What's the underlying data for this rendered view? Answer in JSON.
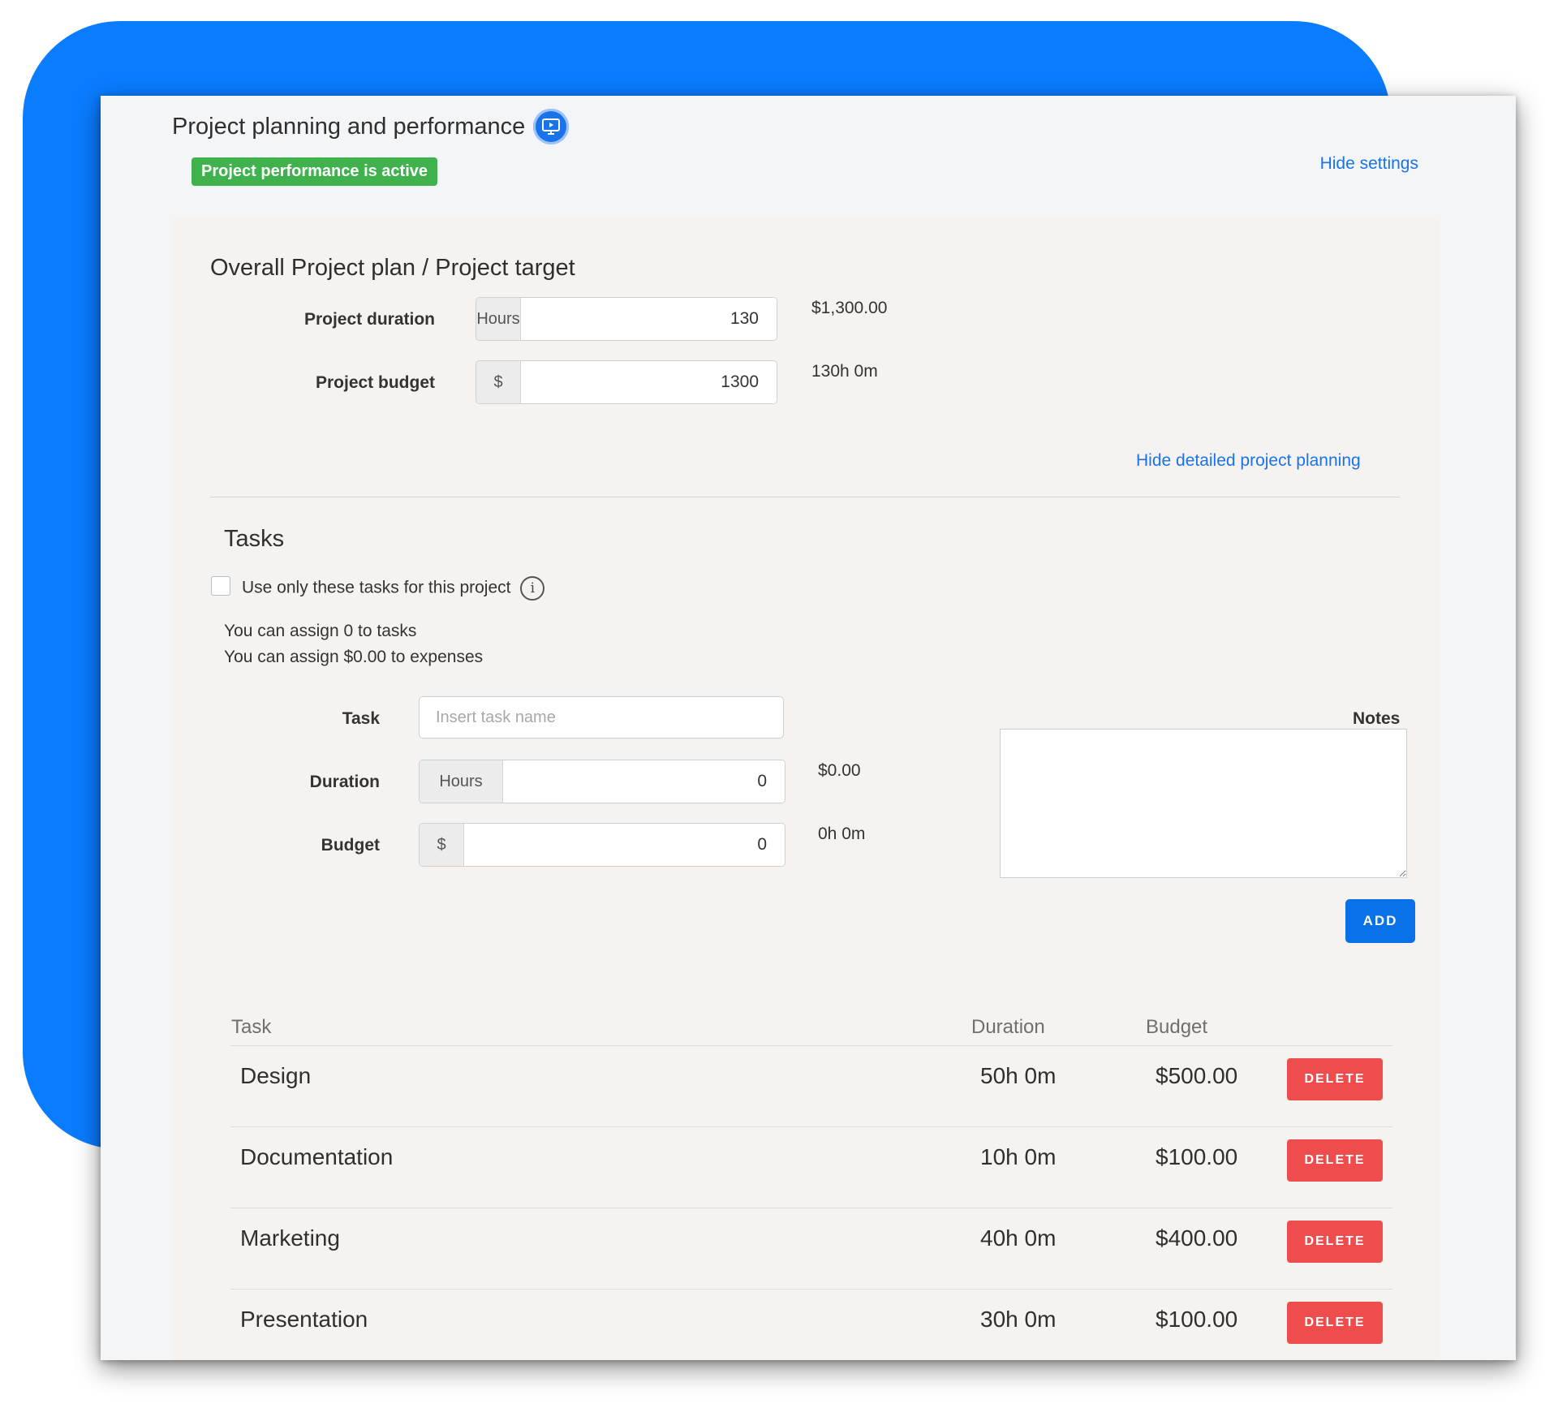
{
  "header": {
    "title": "Project planning and performance",
    "badge": "Project performance is active",
    "hide_settings": "Hide settings"
  },
  "overall": {
    "title": "Overall Project plan / Project target",
    "duration_label": "Project duration",
    "duration_addon": "Hours",
    "duration_value": "130",
    "duration_cost": "$1,300.00",
    "budget_label": "Project budget",
    "budget_addon": "$",
    "budget_value": "1300",
    "budget_time": "130h 0m",
    "hide_detailed": "Hide detailed project planning"
  },
  "tasks": {
    "title": "Tasks",
    "use_only_label": "Use only these tasks for this project",
    "info_glyph": "i",
    "assign_tasks": "You can assign 0 to tasks",
    "assign_expenses": "You can assign $0.00 to expenses",
    "form": {
      "task_label": "Task",
      "task_placeholder": "Insert task name",
      "duration_label": "Duration",
      "duration_addon": "Hours",
      "duration_value": "0",
      "duration_cost": "$0.00",
      "budget_label": "Budget",
      "budget_addon": "$",
      "budget_value": "0",
      "budget_time": "0h 0m",
      "notes_label": "Notes",
      "add_label": "ADD"
    },
    "table": {
      "headers": {
        "task": "Task",
        "duration": "Duration",
        "budget": "Budget"
      },
      "delete_label": "DELETE",
      "rows": [
        {
          "task": "Design",
          "duration": "50h 0m",
          "budget": "$500.00"
        },
        {
          "task": "Documentation",
          "duration": "10h 0m",
          "budget": "$100.00"
        },
        {
          "task": "Marketing",
          "duration": "40h 0m",
          "budget": "$400.00"
        },
        {
          "task": "Presentation",
          "duration": "30h 0m",
          "budget": "$100.00"
        }
      ]
    }
  },
  "colors": {
    "accent": "#1a73e8",
    "badge_green": "#3fb24d",
    "delete_red": "#ef4d4d",
    "backdrop_blue": "#0a7cff"
  }
}
